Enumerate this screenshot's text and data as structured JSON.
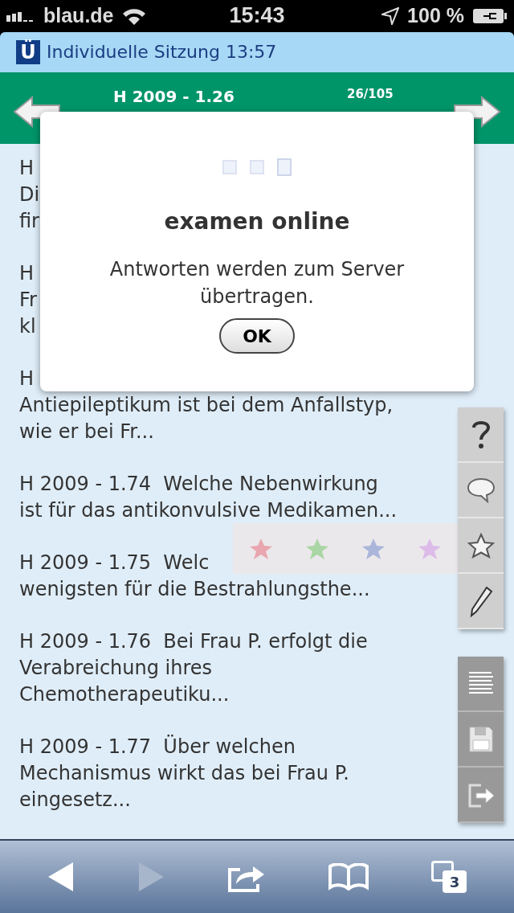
{
  "status_bar": {
    "carrier": "blau.de",
    "time": "15:43",
    "battery": "100 %"
  },
  "session_bar": {
    "badge": "Ü",
    "title": "Individuelle Sitzung 13:57"
  },
  "header": {
    "title": "H 2009 - 1.26",
    "counter": "26/105"
  },
  "questions": [
    {
      "text": "H\nDi\nfir"
    },
    {
      "text": "H\nFr\nkl"
    },
    {
      "text": "H\nAntiepileptikum ist bei dem Anfallstyp,\nwie er bei Fr..."
    },
    {
      "text": "H 2009 - 1.74  Welche Nebenwirkung\nist für das antikonvulsive Medikamen..."
    },
    {
      "text": "H 2009 - 1.75  Welc\nwenigsten für die Bestrahlungsthe..."
    },
    {
      "text": "H 2009 - 1.76  Bei Frau P. erfolgt die\nVerabreichung ihres\nChemotherapeutiku..."
    },
    {
      "text": "H 2009 - 1.77  Über welchen\nMechanismus wirkt das bei Frau P.\neingesetz..."
    }
  ],
  "rating_bar": {
    "stars": [
      {
        "color": "#e9a6ae"
      },
      {
        "color": "#a9d6a4"
      },
      {
        "color": "#aab6da"
      },
      {
        "color": "#dcbbe9"
      }
    ]
  },
  "side_tools": [
    {
      "kind": "help"
    },
    {
      "kind": "comment"
    },
    {
      "kind": "star"
    },
    {
      "kind": "pencil"
    }
  ],
  "side_actions": [
    {
      "kind": "list"
    },
    {
      "kind": "save"
    },
    {
      "kind": "exit"
    }
  ],
  "dialog": {
    "title": "examen online",
    "message": "Antworten werden zum Server übertragen.",
    "button": "OK"
  },
  "browser_toolbar": {
    "back_disabled": false,
    "forward_disabled": true,
    "tab_count": "3"
  }
}
